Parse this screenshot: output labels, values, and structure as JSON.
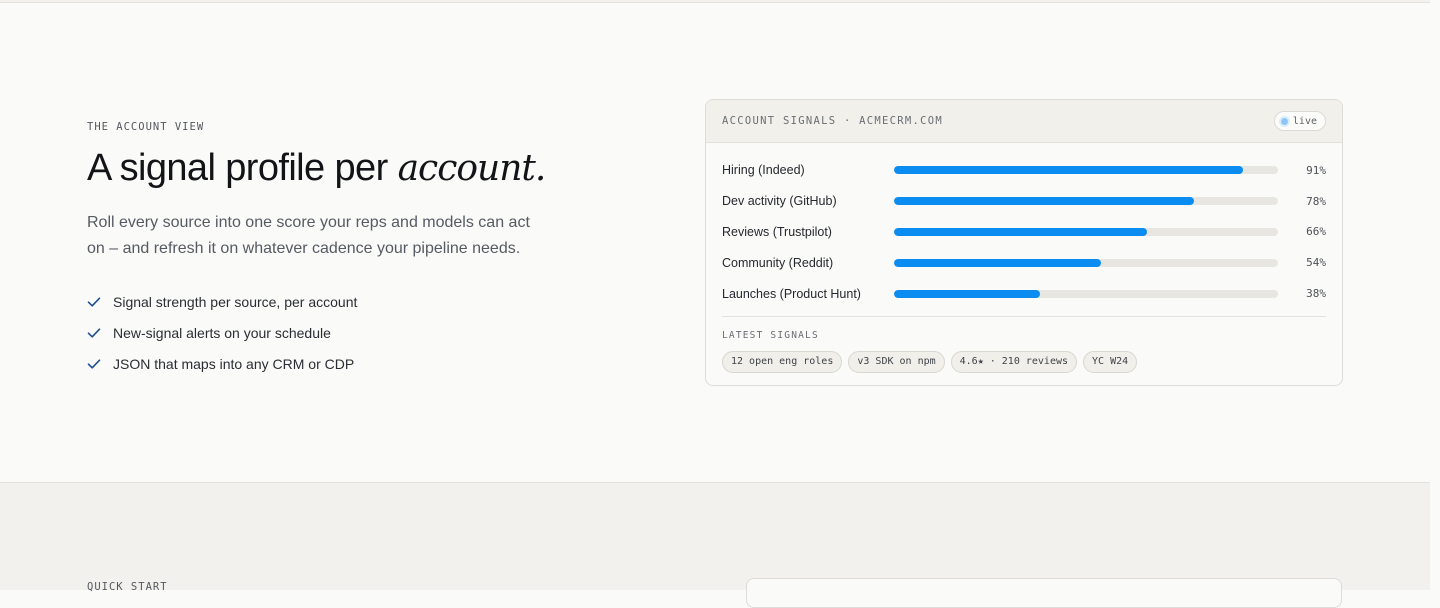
{
  "section": {
    "eyebrow": "THE ACCOUNT VIEW",
    "heading_main": "A signal profile per ",
    "heading_accent": "account.",
    "lede": "Roll every source into one score your reps and models can act on – and refresh it on whatever cadence your pipeline needs.",
    "bullets": [
      "Signal strength per source, per account",
      "New-signal alerts on your schedule",
      "JSON that maps into any CRM or CDP"
    ]
  },
  "card": {
    "title": "ACCOUNT SIGNALS · ACMECRM.COM",
    "live_label": "live",
    "latest_label": "LATEST SIGNALS",
    "chips": [
      "12 open eng roles",
      "v3 SDK on npm",
      "4.6★ · 210 reviews",
      "YC W24"
    ]
  },
  "chart_data": {
    "type": "bar",
    "categories": [
      "Hiring (Indeed)",
      "Dev activity (GitHub)",
      "Reviews (Trustpilot)",
      "Community (Reddit)",
      "Launches (Product Hunt)"
    ],
    "values": [
      91,
      78,
      66,
      54,
      38
    ],
    "value_labels": [
      "91%",
      "78%",
      "66%",
      "54%",
      "38%"
    ],
    "ylim": [
      0,
      100
    ]
  },
  "next_section": {
    "eyebrow": "QUICK START"
  },
  "colors": {
    "accent": "#0a8cf0",
    "check": "#1c4f8f"
  },
  "icons": {
    "check": "check-icon",
    "live": "live-dot-icon"
  }
}
